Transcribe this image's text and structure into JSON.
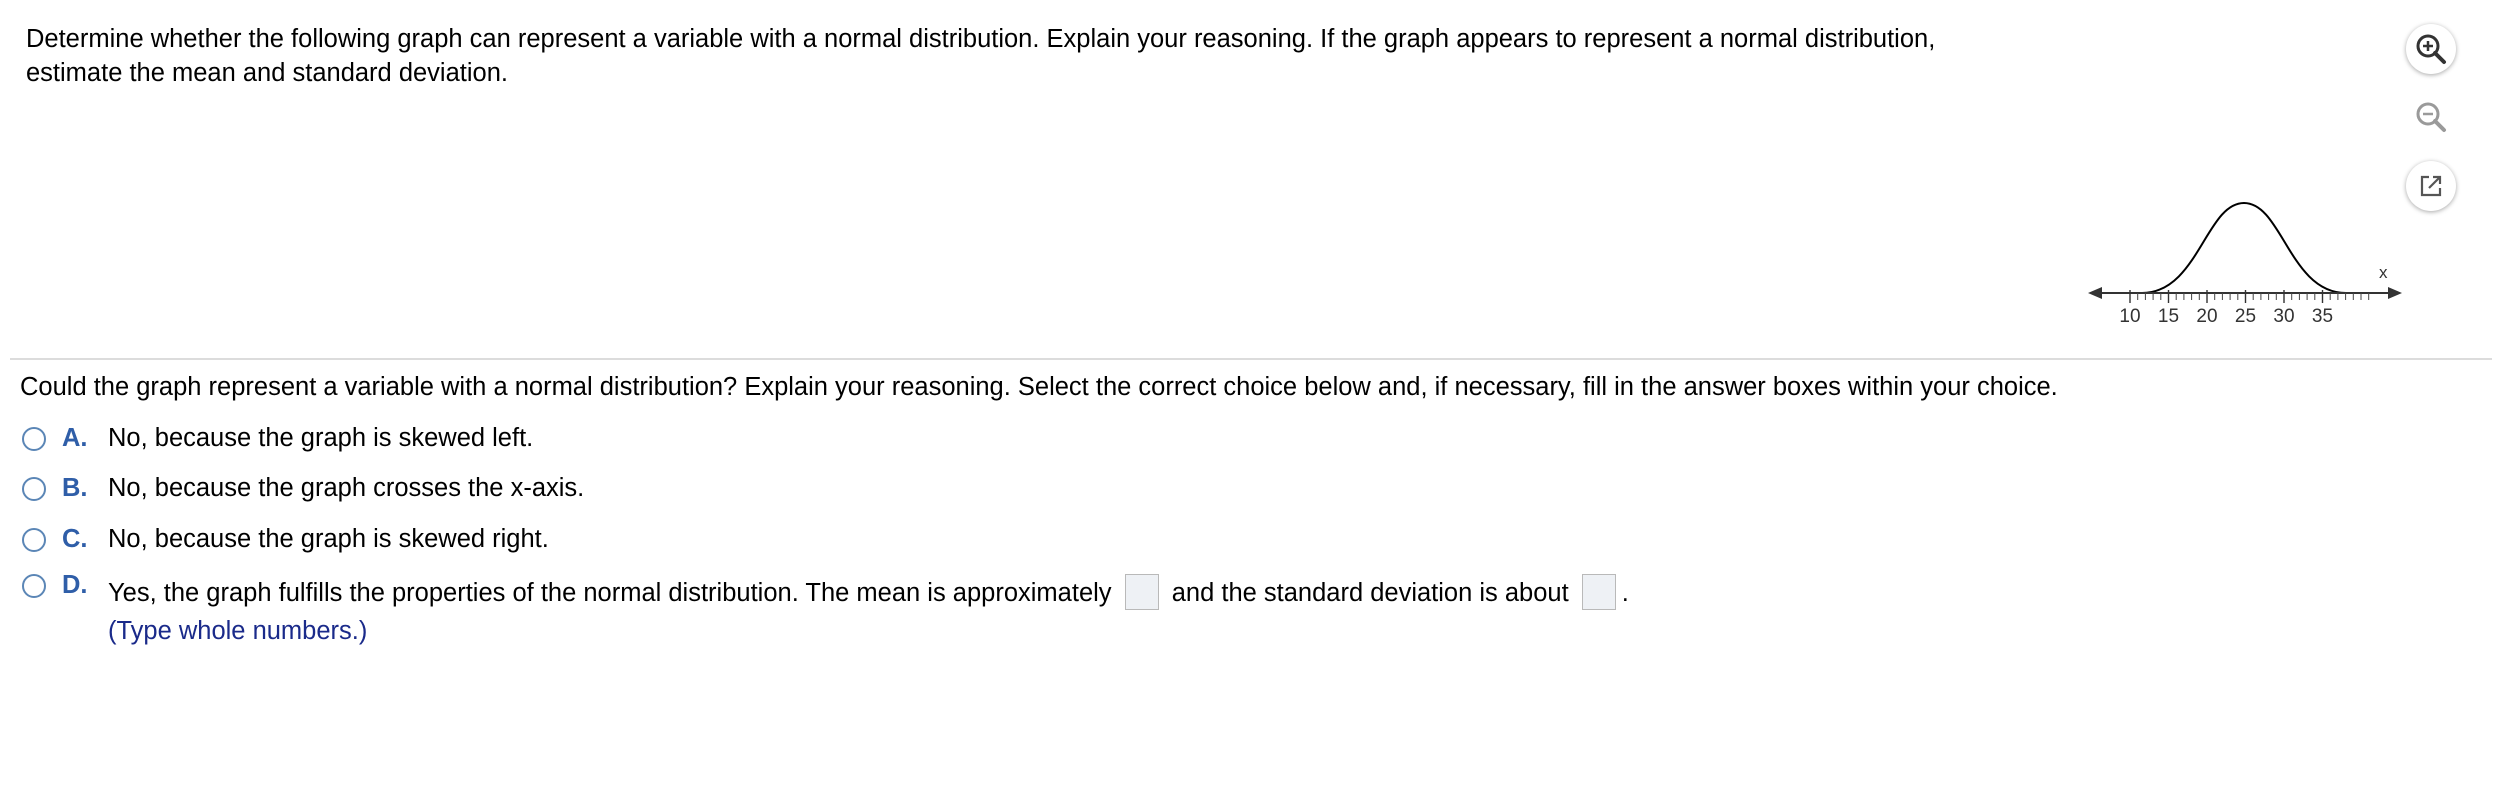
{
  "question": {
    "text": "Determine whether the following graph can represent a variable with a normal distribution. Explain your reasoning. If the graph appears to represent a normal distribution, estimate the mean and standard deviation."
  },
  "toolbar": {
    "zoom_in_icon": "zoom-in-icon",
    "zoom_out_icon": "zoom-out-icon",
    "popout_icon": "popout-icon"
  },
  "graph": {
    "axis_label": "x",
    "tick_labels": [
      "10",
      "15",
      "20",
      "25",
      "30",
      "35"
    ]
  },
  "prompt": {
    "text": "Could the graph represent a variable with a normal distribution? Explain your reasoning. Select the correct choice below and, if necessary, fill in the answer boxes within your choice."
  },
  "choices": [
    {
      "letter": "A.",
      "text": "No, because the graph is skewed left."
    },
    {
      "letter": "B.",
      "text": "No, because the graph crosses the x-axis."
    },
    {
      "letter": "C.",
      "text": "No, because the graph is skewed right."
    },
    {
      "letter": "D.",
      "text_part1": "Yes, the graph fulfills the properties of the normal distribution. The mean is approximately",
      "text_part2": "and the standard deviation is about",
      "text_end": ".",
      "hint": "(Type whole numbers.)",
      "mean_value": "",
      "sd_value": ""
    }
  ],
  "colors": {
    "choice_letter": "#2f5ea8",
    "radio_border": "#5b86b6",
    "hint_text": "#1a2a8a",
    "answer_box_bg": "#eef1f5"
  }
}
